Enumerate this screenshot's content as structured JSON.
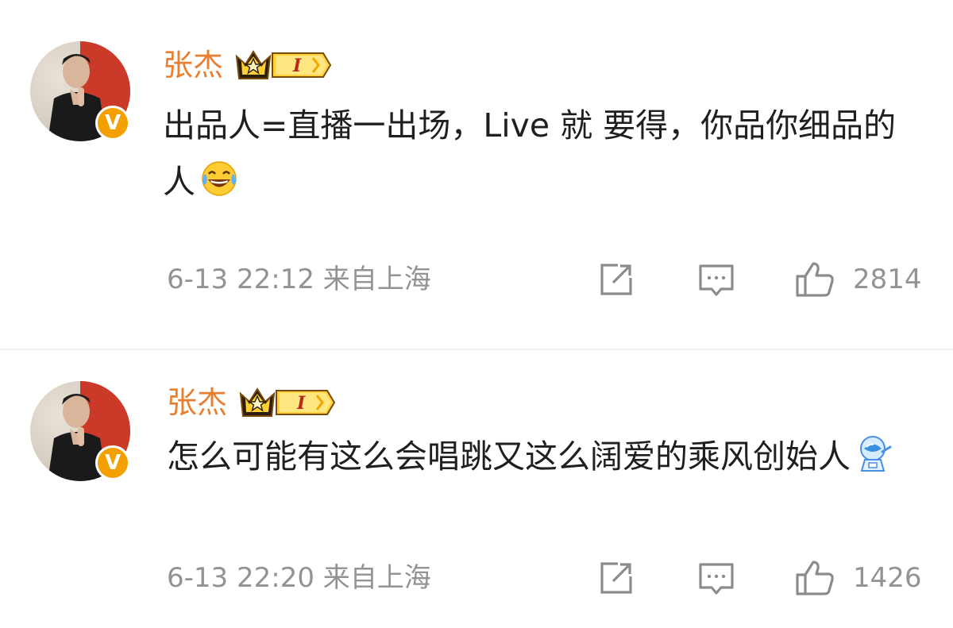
{
  "comments": [
    {
      "username": "张杰",
      "vip_level": "I",
      "verified_mark": "V",
      "text": "出品人=直播一出场，Live 就 要得，你品你细品的人",
      "emoji": "laugh-cry-emoji",
      "timestamp": "6-13 22:12 来自上海",
      "likes": "2814"
    },
    {
      "username": "张杰",
      "vip_level": "I",
      "verified_mark": "V",
      "text": "怎么可能有这么会唱跳又这么阔爱的乘风创始人",
      "emoji": "astronaut-emoji",
      "timestamp": "6-13 22:20 来自上海",
      "likes": "1426"
    }
  ],
  "colors": {
    "username": "#e87e2e",
    "text": "#1f1f1f",
    "meta": "#939393",
    "verified": "#f3a000",
    "divider": "#f0f0f0"
  }
}
